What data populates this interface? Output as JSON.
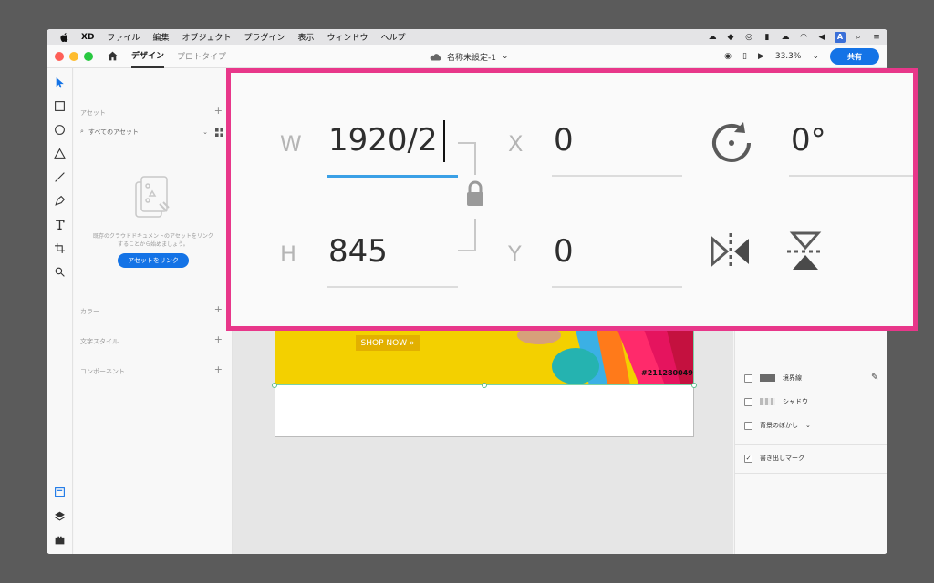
{
  "menubar": {
    "items": [
      "XD",
      "ファイル",
      "編集",
      "オブジェクト",
      "プラグイン",
      "表示",
      "ウィンドウ",
      "ヘルプ"
    ],
    "status_a": "A"
  },
  "titlebar": {
    "tabs": [
      "デザイン",
      "プロトタイプ"
    ],
    "doc_title": "名称未設定-1",
    "zoom": "33.3%",
    "share_label": "共有"
  },
  "assets_panel": {
    "header": "アセット",
    "search_placeholder": "すべてのアセット",
    "empty_text": "既存のクラウドドキュメントのアセットをリンクすることから始めましょう。",
    "link_button": "アセットをリンク",
    "sections": [
      "カラー",
      "文字スタイル",
      "コンポーネント"
    ]
  },
  "artboard": {
    "shop_button": "SHOP NOW »",
    "image_code": "#211280049"
  },
  "properties": {
    "border_label": "境界線",
    "shadow_label": "シャドウ",
    "bg_blur_label": "背景のぼかし",
    "export_mark_label": "書き出しマーク"
  },
  "zoom_panel": {
    "w_label": "W",
    "w_value": "1920/2",
    "h_label": "H",
    "h_value": "845",
    "x_label": "X",
    "x_value": "0",
    "y_label": "Y",
    "y_value": "0",
    "rotation_value": "0°"
  },
  "colors": {
    "accent": "#1473e6",
    "highlight_frame": "#e8378a",
    "active_field": "#3aa0e6",
    "banner_yellow": "#f3d000"
  }
}
